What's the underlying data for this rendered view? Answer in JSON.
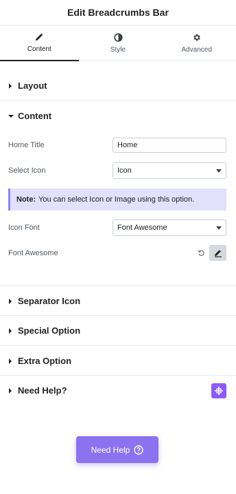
{
  "header": {
    "title": "Edit Breadcrumbs Bar"
  },
  "tabs": [
    {
      "label": "Content",
      "icon": "pencil-icon",
      "active": true
    },
    {
      "label": "Style",
      "icon": "half-circle-icon",
      "active": false
    },
    {
      "label": "Advanced",
      "icon": "gear-icon",
      "active": false
    }
  ],
  "sections": {
    "layout": {
      "title": "Layout",
      "expanded": false
    },
    "content": {
      "title": "Content",
      "expanded": true,
      "home_title": {
        "label": "Home Title",
        "value": "Home"
      },
      "select_icon": {
        "label": "Select Icon",
        "value": "Icon"
      },
      "note": {
        "prefix": "Note:",
        "text": "You can select Icon or Image using this option."
      },
      "icon_font": {
        "label": "Icon Font",
        "value": "Font Awesome"
      },
      "font_awesome": {
        "label": "Font Awesome"
      }
    },
    "separator_icon": {
      "title": "Separator Icon",
      "expanded": false
    },
    "special_option": {
      "title": "Special Option",
      "expanded": false
    },
    "extra_option": {
      "title": "Extra Option",
      "expanded": false
    },
    "need_help": {
      "title": "Need Help?",
      "expanded": false
    }
  },
  "need_help_button": {
    "label": "Need Help"
  },
  "colors": {
    "accent": "#8b73f0",
    "note_bg": "#e2e0fb",
    "note_border": "#8b87ef",
    "help_icon": "#8b5cf6"
  }
}
